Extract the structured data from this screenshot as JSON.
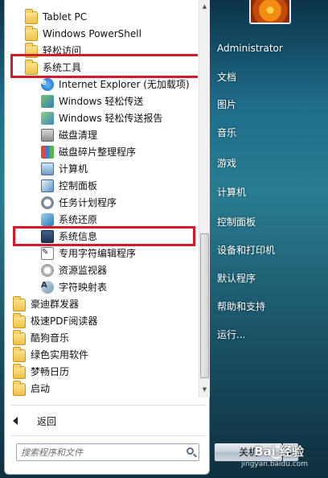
{
  "programs": [
    {
      "label": "Tablet PC",
      "icon": "folder-icon",
      "indent": 0
    },
    {
      "label": "Windows PowerShell",
      "icon": "folder-icon",
      "indent": 0
    },
    {
      "label": "轻松访问",
      "icon": "folder-icon",
      "indent": 0
    },
    {
      "label": "系统工具",
      "icon": "folder-icon",
      "indent": 0
    },
    {
      "label": "Internet Explorer (无加载项)",
      "icon": "internet-explorer-icon",
      "indent": 1
    },
    {
      "label": "Windows 轻松传送",
      "icon": "easy-transfer-icon",
      "indent": 1
    },
    {
      "label": "Windows 轻松传送报告",
      "icon": "easy-transfer-report-icon",
      "indent": 1
    },
    {
      "label": "磁盘清理",
      "icon": "disk-cleanup-icon",
      "indent": 1
    },
    {
      "label": "磁盘碎片整理程序",
      "icon": "defragmenter-icon",
      "indent": 1
    },
    {
      "label": "计算机",
      "icon": "computer-icon",
      "indent": 1
    },
    {
      "label": "控制面板",
      "icon": "control-panel-icon",
      "indent": 1
    },
    {
      "label": "任务计划程序",
      "icon": "task-scheduler-icon",
      "indent": 1
    },
    {
      "label": "系统还原",
      "icon": "system-restore-icon",
      "indent": 1
    },
    {
      "label": "系统信息",
      "icon": "system-info-icon",
      "indent": 1
    },
    {
      "label": "专用字符编辑程序",
      "icon": "char-editor-icon",
      "indent": 1
    },
    {
      "label": "资源监视器",
      "icon": "resource-monitor-icon",
      "indent": 1
    },
    {
      "label": "字符映射表",
      "icon": "character-map-icon",
      "indent": 1
    },
    {
      "label": "豪迪群发器",
      "icon": "folder-icon",
      "indent": 0
    },
    {
      "label": "极速PDF阅读器",
      "icon": "folder-icon",
      "indent": 0
    },
    {
      "label": "酷狗音乐",
      "icon": "folder-icon",
      "indent": 0
    },
    {
      "label": "绿色实用软件",
      "icon": "folder-icon",
      "indent": 0
    },
    {
      "label": "梦畅日历",
      "icon": "folder-icon",
      "indent": 0
    },
    {
      "label": "启动",
      "icon": "folder-icon",
      "indent": 0
    }
  ],
  "back_label": "返回",
  "search": {
    "placeholder": "搜索程序和文件"
  },
  "right_menu": [
    "Administrator",
    "文档",
    "图片",
    "音乐",
    "游戏",
    "计算机",
    "控制面板",
    "设备和打印机",
    "默认程序",
    "帮助和支持",
    "运行..."
  ],
  "shutdown_label": "关机",
  "watermark": {
    "main": "Bai 经验",
    "sub": "jingyan.baidu.com"
  },
  "colors": {
    "highlight_box": "#d4192b",
    "panel_bg": "#ffffff",
    "right_text": "#ffffff"
  }
}
